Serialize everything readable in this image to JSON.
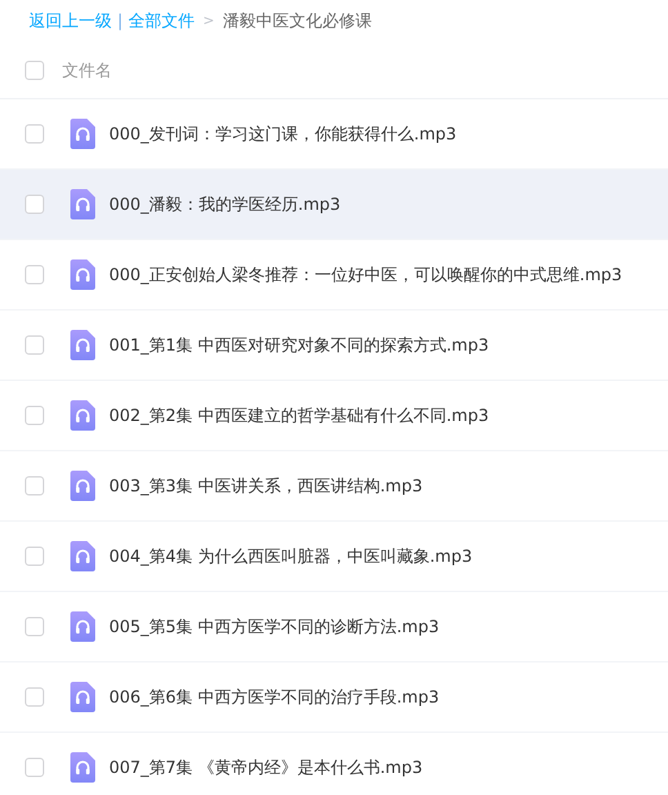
{
  "breadcrumb": {
    "back": "返回上一级",
    "separator": "|",
    "root": "全部文件",
    "arrow": ">",
    "current": "潘毅中医文化必修课"
  },
  "table": {
    "columns": [
      {
        "label": "文件名",
        "checked": false
      }
    ],
    "rows": [
      {
        "name": "000_发刊词：学习这门课，你能获得什么.mp3",
        "checked": false,
        "highlighted": false
      },
      {
        "name": "000_潘毅：我的学医经历.mp3",
        "checked": false,
        "highlighted": true
      },
      {
        "name": "000_正安创始人梁冬推荐：一位好中医，可以唤醒你的中式思维.mp3",
        "checked": false,
        "highlighted": false
      },
      {
        "name": "001_第1集 中西医对研究对象不同的探索方式.mp3",
        "checked": false,
        "highlighted": false
      },
      {
        "name": "002_第2集 中西医建立的哲学基础有什么不同.mp3",
        "checked": false,
        "highlighted": false
      },
      {
        "name": "003_第3集 中医讲关系，西医讲结构.mp3",
        "checked": false,
        "highlighted": false
      },
      {
        "name": "004_第4集 为什么西医叫脏器，中医叫藏象.mp3",
        "checked": false,
        "highlighted": false
      },
      {
        "name": "005_第5集 中西方医学不同的诊断方法.mp3",
        "checked": false,
        "highlighted": false
      },
      {
        "name": "006_第6集 中西方医学不同的治疗手段.mp3",
        "checked": false,
        "highlighted": false
      },
      {
        "name": "007_第7集 《黄帝内经》是本什么书.mp3",
        "checked": false,
        "highlighted": false
      }
    ]
  }
}
